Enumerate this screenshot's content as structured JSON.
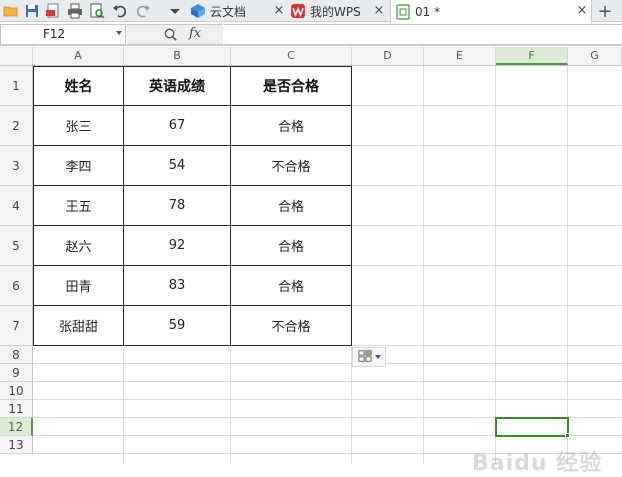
{
  "toolbar": {
    "icons": [
      "open-folder-icon",
      "save-icon",
      "export-pdf-icon",
      "print-icon",
      "print-preview-icon",
      "undo-icon",
      "redo-icon",
      "more-dropdown-icon"
    ]
  },
  "tabs": [
    {
      "label": "云文档",
      "icon": "cloud-docs-icon",
      "close": "×"
    },
    {
      "label": "我的WPS",
      "icon": "wps-icon",
      "close": "×"
    },
    {
      "label": "01 *",
      "icon": "spreadsheet-doc-icon",
      "close": "×",
      "active": true
    }
  ],
  "new_tab_label": "+",
  "formula_bar": {
    "name_box": "F12",
    "fx_label": "fx",
    "formula_value": ""
  },
  "columns": [
    "A",
    "B",
    "C",
    "D",
    "E",
    "F",
    "G"
  ],
  "rows": [
    "1",
    "2",
    "3",
    "4",
    "5",
    "6",
    "7",
    "8",
    "9",
    "10",
    "11",
    "12",
    "13"
  ],
  "selection": {
    "cell": "F12",
    "column": "F",
    "row": "12"
  },
  "table": {
    "headers": [
      "姓名",
      "英语成绩",
      "是否合格"
    ],
    "rows": [
      [
        "张三",
        "67",
        "合格"
      ],
      [
        "李四",
        "54",
        "不合格"
      ],
      [
        "王五",
        "78",
        "合格"
      ],
      [
        "赵六",
        "92",
        "合格"
      ],
      [
        "田青",
        "83",
        "合格"
      ],
      [
        "张甜甜",
        "59",
        "不合格"
      ]
    ]
  },
  "paste_options_icon": "paste-options-icon",
  "watermark": "Baidu 经验",
  "colors": {
    "selection_green": "#3c8a2e",
    "header_bg": "#f3f4f6",
    "tab_bar_bg": "#e9ecef"
  }
}
